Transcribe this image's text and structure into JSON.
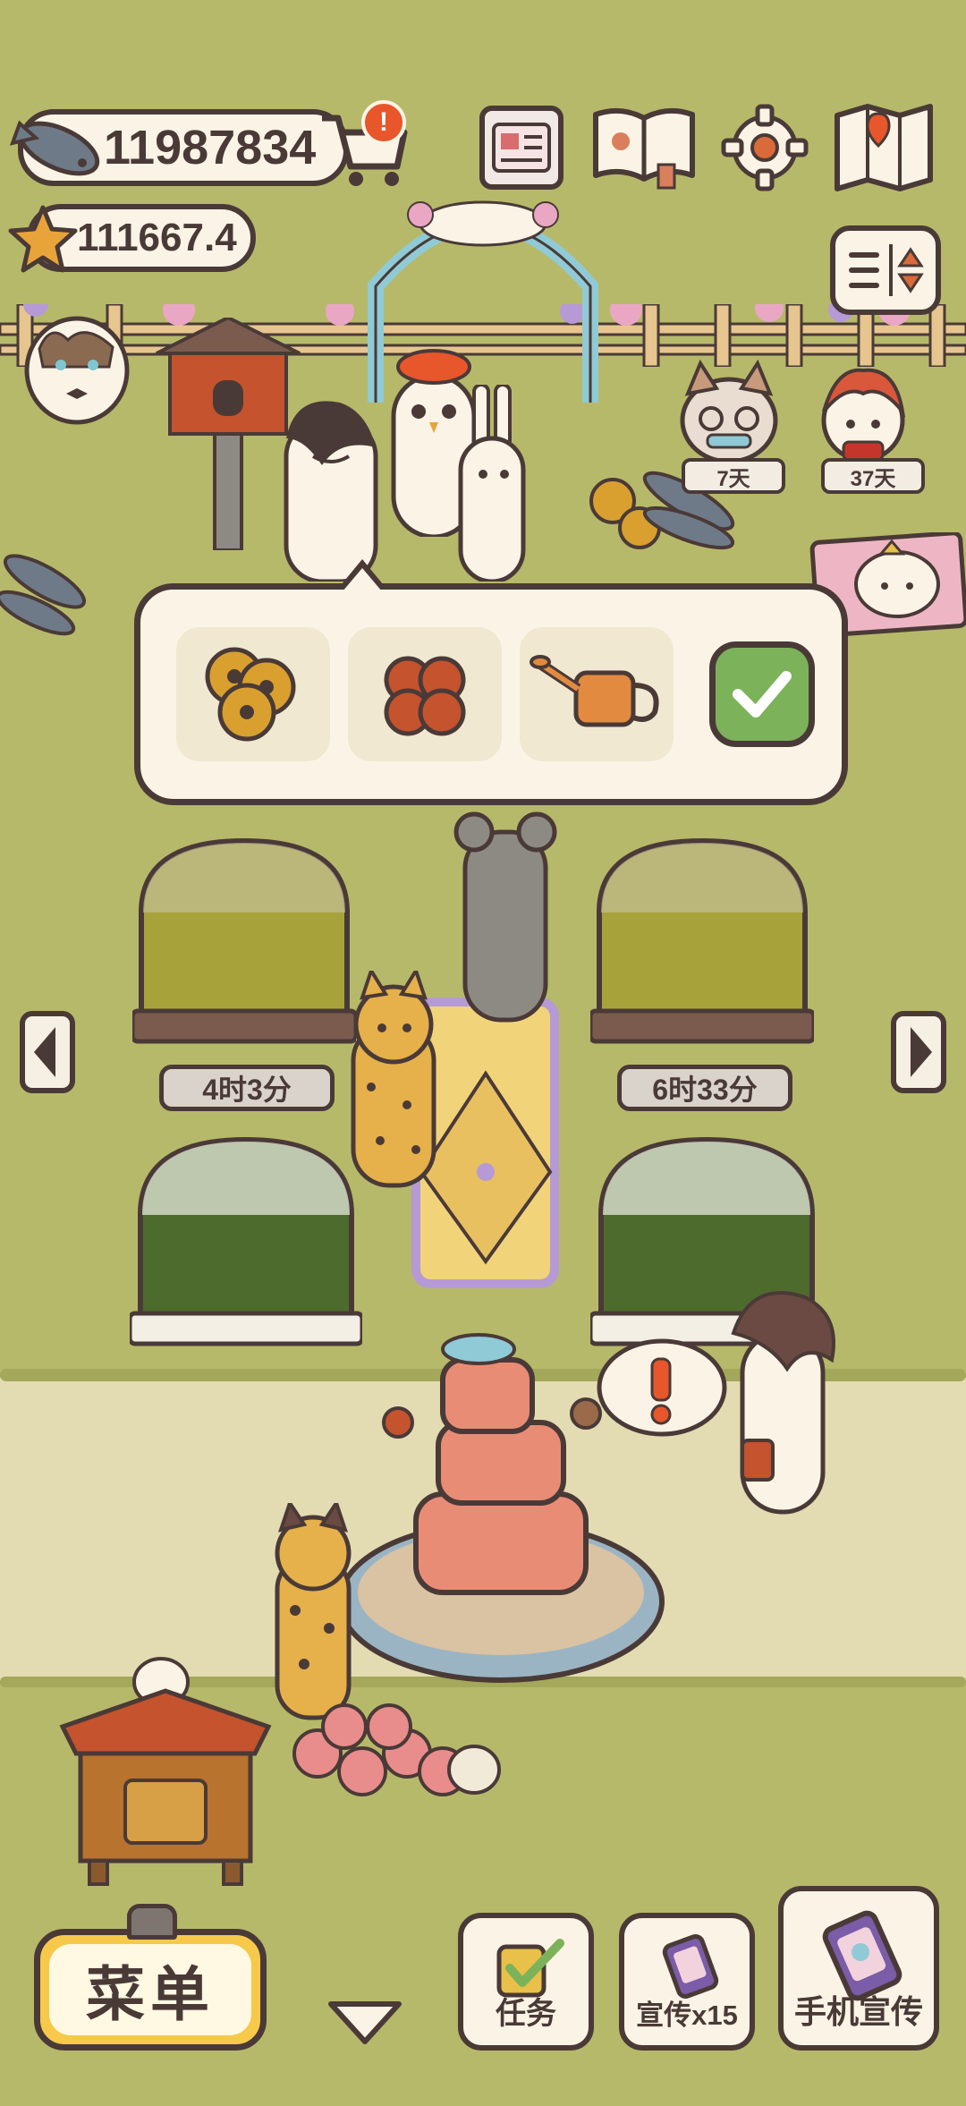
{
  "hud": {
    "fish_currency": "11987834",
    "star_currency": "111667.4"
  },
  "toolbar": {
    "icons": [
      "shop-cart-icon",
      "notice-icon",
      "newspaper-icon",
      "guidebook-icon",
      "settings-gear-icon",
      "map-icon",
      "sort-toggle-icon"
    ]
  },
  "visitors": [
    {
      "name": "cat-visitor",
      "days": "7天"
    },
    {
      "name": "girl-visitor",
      "days": "37天"
    }
  ],
  "craft_popup": {
    "items": [
      "sunflower-seeds",
      "bread-rolls",
      "watering-can"
    ],
    "confirm_icon": "checkmark-icon"
  },
  "greenhouses": [
    {
      "timer": "4时3分"
    },
    {
      "timer": "6时33分"
    },
    {
      "timer": ""
    },
    {
      "timer": ""
    }
  ],
  "bottom_bar": {
    "menu_label": "菜单",
    "task_label": "任务",
    "promo_label": "宣传x15",
    "phone_promo_label": "手机宣传"
  },
  "colors": {
    "grass": "#b7b96a",
    "path": "#e3dbb2",
    "outline": "#4a3a37",
    "cream": "#fbf4e6",
    "menu_yellow": "#f6c94a",
    "alert_red": "#e8562c",
    "confirm_green": "#7cb35a"
  }
}
